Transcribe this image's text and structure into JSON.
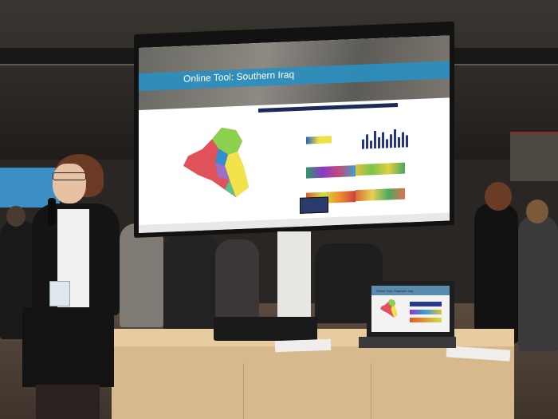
{
  "screen": {
    "title": "Online Tool: Southern Iraq",
    "panel_labels": [
      "",
      "",
      "",
      ""
    ]
  },
  "laptop": {
    "title": "Online Tool: Southern Iraq"
  },
  "colors": {
    "banner_blue": "#2a8fc0",
    "map_red": "#e0525a",
    "map_green": "#8cd14e",
    "map_yellow": "#f3e34a",
    "table_wood": "#d8b98e"
  }
}
